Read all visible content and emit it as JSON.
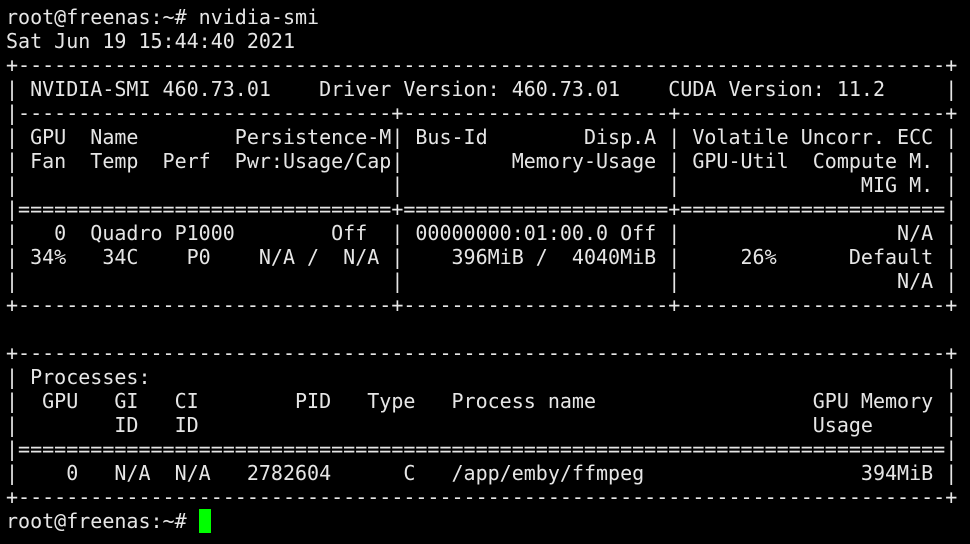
{
  "terminal": {
    "cursor_color": "#00ff00",
    "text_color": "#e6e6e6",
    "background_color": "#000000",
    "lines": [
      "root@freenas:~# nvidia-smi",
      "Sat Jun 19 15:44:40 2021",
      "+-----------------------------------------------------------------------------+",
      "| NVIDIA-SMI 460.73.01    Driver Version: 460.73.01    CUDA Version: 11.2     |",
      "|-------------------------------+----------------------+----------------------+",
      "| GPU  Name        Persistence-M| Bus-Id        Disp.A | Volatile Uncorr. ECC |",
      "| Fan  Temp  Perf  Pwr:Usage/Cap|         Memory-Usage | GPU-Util  Compute M. |",
      "|                               |                      |               MIG M. |",
      "|===============================+======================+======================|",
      "|   0  Quadro P1000        Off  | 00000000:01:00.0 Off |                  N/A |",
      "| 34%   34C    P0    N/A /  N/A |    396MiB /  4040MiB |     26%      Default |",
      "|                               |                      |                  N/A |",
      "+-------------------------------+----------------------+----------------------+",
      "",
      "+-----------------------------------------------------------------------------+",
      "| Processes:                                                                  |",
      "|  GPU   GI   CI        PID   Type   Process name                  GPU Memory |",
      "|        ID   ID                                                   Usage      |",
      "|=============================================================================|",
      "|    0   N/A  N/A   2782604      C   /app/emby/ffmpeg                  394MiB |",
      "+-----------------------------------------------------------------------------+",
      "root@freenas:~# "
    ]
  }
}
